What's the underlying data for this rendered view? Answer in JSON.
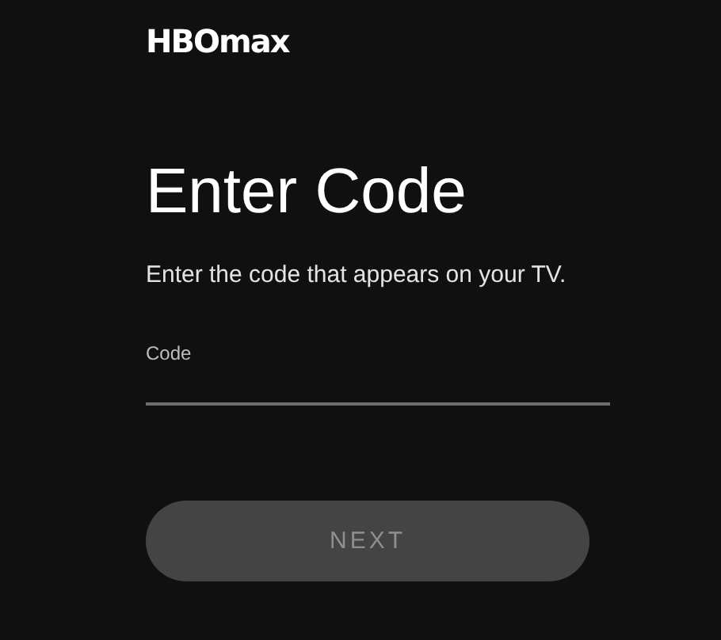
{
  "logo": {
    "text": "HBOmax"
  },
  "title": "Enter Code",
  "instructions": "Enter the code that appears on your TV.",
  "code_field": {
    "label": "Code"
  },
  "next_button": {
    "label": "NEXT",
    "disabled": true
  }
}
